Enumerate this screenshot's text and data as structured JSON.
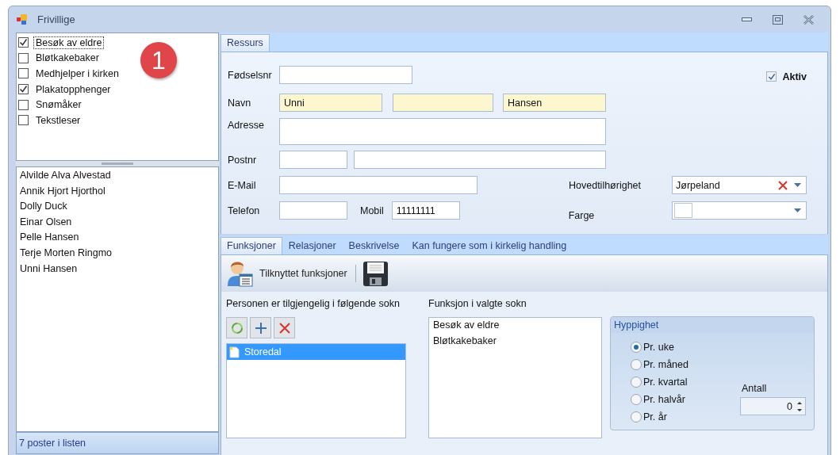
{
  "window": {
    "title": "Frivillige"
  },
  "badge": "1",
  "function_checklist": [
    {
      "label": "Besøk av eldre",
      "checked": true,
      "selected": true
    },
    {
      "label": "Bløtkakebaker",
      "checked": false,
      "selected": false
    },
    {
      "label": "Medhjelper i kirken",
      "checked": false,
      "selected": false
    },
    {
      "label": "Plakatopphenger",
      "checked": true,
      "selected": false
    },
    {
      "label": "Snømåker",
      "checked": false,
      "selected": false
    },
    {
      "label": "Tekstleser",
      "checked": false,
      "selected": false
    }
  ],
  "persons": [
    "Alvilde Alva Alvestad",
    "Annik Hjort Hjorthol",
    "Dolly Duck",
    "Einar Olsen",
    "Pelle Hansen",
    "Terje Morten Ringmo",
    "Unni Hansen"
  ],
  "status_bar": "7 poster i listen",
  "main_tabs": [
    {
      "label": "Ressurs",
      "selected": true
    }
  ],
  "form": {
    "fodselsnr_label": "Fødselsnr",
    "aktiv": {
      "label": "Aktiv",
      "checked": true
    },
    "navn": {
      "label": "Navn",
      "first": "Unni",
      "last": "Hansen"
    },
    "adresse_label": "Adresse",
    "postnr_label": "Postnr",
    "email_label": "E-Mail",
    "telefon_label": "Telefon",
    "mobil": {
      "label": "Mobil",
      "value": "11111111"
    },
    "hovedtilhorighet": {
      "label": "Hovedtilhørighet",
      "value": "Jørpeland"
    },
    "farge_label": "Farge"
  },
  "sub_tabs": [
    {
      "label": "Funksjoner",
      "selected": true
    },
    {
      "label": "Relasjoner",
      "selected": false
    },
    {
      "label": "Beskrivelse",
      "selected": false
    },
    {
      "label": "Kan fungere som i kirkelig handling",
      "selected": false
    }
  ],
  "toolbar": {
    "label": "Tilknyttet funksjoner"
  },
  "parishes": {
    "title": "Personen er tilgjengelig i følgende sokn",
    "items": [
      {
        "label": "Storedal",
        "selected": true
      }
    ]
  },
  "functions": {
    "title": "Funksjon i valgte sokn",
    "items": [
      "Besøk av eldre",
      "Bløtkakebaker"
    ]
  },
  "frequency": {
    "title": "Hyppighet",
    "options": [
      {
        "label": "Pr. uke",
        "selected": true
      },
      {
        "label": "Pr. måned",
        "selected": false
      },
      {
        "label": "Pr. kvartal",
        "selected": false
      },
      {
        "label": "Pr. halvår",
        "selected": false
      },
      {
        "label": "Pr. år",
        "selected": false
      }
    ],
    "count_label": "Antall",
    "count": "0"
  }
}
